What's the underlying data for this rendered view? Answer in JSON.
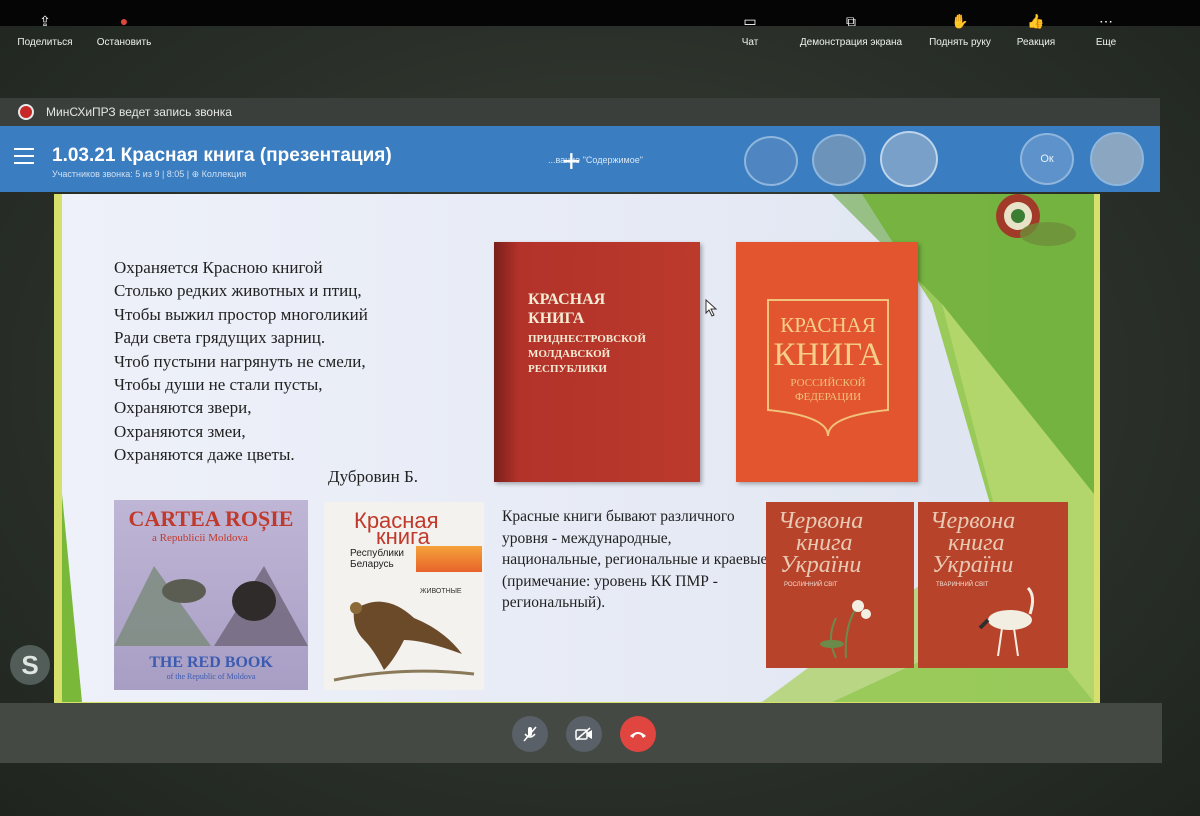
{
  "recording": {
    "text": "МинСХиПРЗ ведет запись звонка"
  },
  "header": {
    "title": "1.03.21 Красная книга (презентация)",
    "subtitle": "Участников звонка: 5 из 9 | 8:05 | ⊕ Коллекция",
    "share_hint": "...вание \"Содержимое\"",
    "avatar_initials": "Ок"
  },
  "slide": {
    "poem_lines": [
      "Охраняется Красною книгой",
      "Столько редких животных и птиц,",
      "Чтобы выжил простор многоликий",
      "Ради света грядущих зарниц.",
      "Чтоб пустыни нагрянуть не смели,",
      "Чтобы души не стали пусты,",
      "Охраняются звери,",
      "Охраняются змеи,",
      "Охраняются даже цветы."
    ],
    "poem_author": "Дубровин Б.",
    "book_pmr": [
      "КРАСНАЯ",
      "КНИГА",
      "ПРИДНЕСТРОВСКОЙ",
      "МОЛДАВСКОЙ",
      "РЕСПУБЛИКИ"
    ],
    "book_rf": [
      "КРАСНАЯ",
      "КНИГА",
      "РОССИЙСКОЙ",
      "ФЕДЕРАЦИИ"
    ],
    "book_md": {
      "title": "CARTEA ROȘIE",
      "subtitle": "a Republicii Moldova",
      "en_title": "THE RED BOOK",
      "en_subtitle": "of the Republic of Moldova"
    },
    "book_by": {
      "title1": "Красная",
      "title2": "книга",
      "subtitle": "Республики Беларусь",
      "section": "ЖИВОТНЫЕ"
    },
    "book_ua": {
      "title1": "Червона",
      "title2": "книга",
      "title3": "України",
      "vol1": "РОСЛИННИЙ СВІТ",
      "vol2": "ТВАРИННИЙ СВІТ"
    },
    "info_text": "Красные книги бывают различного уровня - международные, национальные, региональные и краевые (примечание: уровень КК ПМР - региональный)."
  },
  "toolbar": {
    "share_label": "Поделиться",
    "stop_label": "Остановить",
    "chat_label": "Чат",
    "screen_share_label": "Демонстрация экрана",
    "raise_hand_label": "Поднять руку",
    "reaction_label": "Реакция",
    "more_label": "Еще"
  },
  "colors": {
    "header_blue": "#3a7dc0",
    "end_call_red": "#e0453f",
    "slide_green": "#7ab83a"
  }
}
